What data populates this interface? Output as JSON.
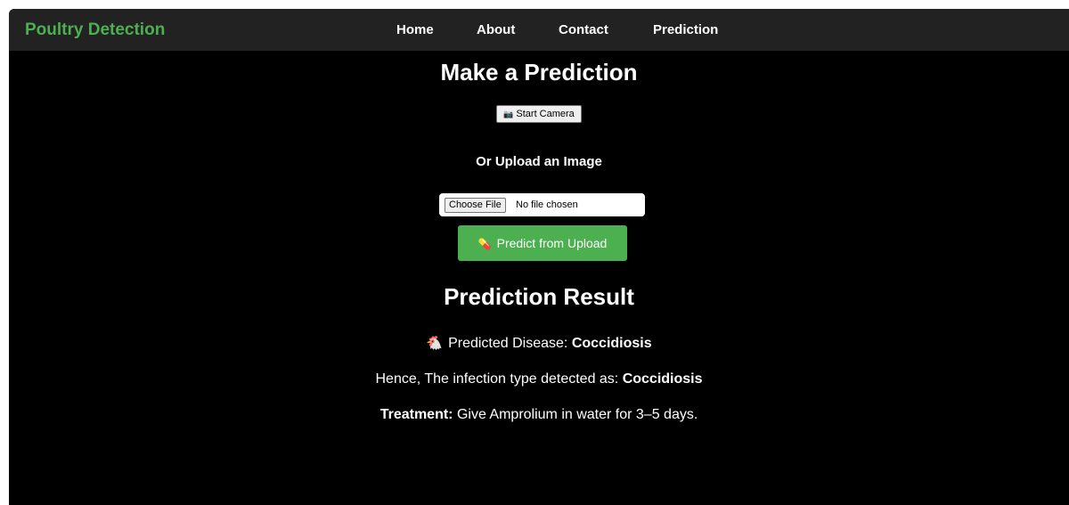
{
  "navbar": {
    "brand": "Poultry Detection",
    "links": [
      "Home",
      "About",
      "Contact",
      "Prediction"
    ]
  },
  "main": {
    "title": "Make a Prediction",
    "camera_button": "Start Camera",
    "camera_icon": "camera-icon",
    "upload_heading": "Or Upload an Image",
    "file_input": {
      "button": "Choose File",
      "status": "No file chosen"
    },
    "predict_button": "Predict from Upload",
    "predict_icon": "pill-icon"
  },
  "result": {
    "heading": "Prediction Result",
    "predicted_label": "Predicted Disease:",
    "predicted_value": "Coccidiosis",
    "infection_label": "Hence, The infection type detected as:",
    "infection_value": "Coccidiosis",
    "treatment_label": "Treatment:",
    "treatment_value": "Give Amprolium in water for 3–5 days."
  },
  "colors": {
    "brand": "#4caf50",
    "navbar_bg": "#222222",
    "page_bg": "#000000",
    "predict_button_bg": "#4caf50"
  }
}
